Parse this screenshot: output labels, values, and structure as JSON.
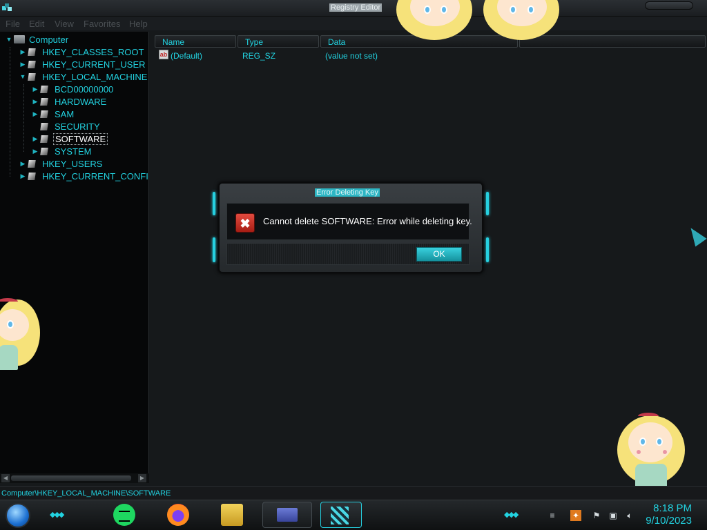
{
  "window": {
    "title": "Registry Editor",
    "menu": [
      "File",
      "Edit",
      "View",
      "Favorites",
      "Help"
    ]
  },
  "tree": {
    "root": "Computer",
    "items": [
      {
        "label": "HKEY_CLASSES_ROOT"
      },
      {
        "label": "HKEY_CURRENT_USER"
      },
      {
        "label": "HKEY_LOCAL_MACHINE"
      },
      {
        "label": "BCD00000000"
      },
      {
        "label": "HARDWARE"
      },
      {
        "label": "SAM"
      },
      {
        "label": "SECURITY"
      },
      {
        "label": "SOFTWARE"
      },
      {
        "label": "SYSTEM"
      },
      {
        "label": "HKEY_USERS"
      },
      {
        "label": "HKEY_CURRENT_CONFI"
      }
    ],
    "selected": "SOFTWARE"
  },
  "list": {
    "columns": [
      "Name",
      "Type",
      "Data"
    ],
    "rows": [
      {
        "name": "(Default)",
        "type": "REG_SZ",
        "data": "(value not set)"
      }
    ]
  },
  "statusbar": {
    "path": "Computer\\HKEY_LOCAL_MACHINE\\SOFTWARE"
  },
  "dialog": {
    "title": "Error Deleting Key",
    "message": "Cannot delete SOFTWARE:  Error while deleting key.",
    "ok_label": "OK"
  },
  "taskbar": {
    "apps": [
      "spotify-icon",
      "firefox-icon",
      "file-explorer-icon",
      "control-panel-icon",
      "registry-editor-icon"
    ],
    "clock_time": "8:18 PM",
    "clock_date": "9/10/2023"
  },
  "colors": {
    "accent": "#22d2e0",
    "background": "#16191b",
    "error": "#d6362b"
  }
}
